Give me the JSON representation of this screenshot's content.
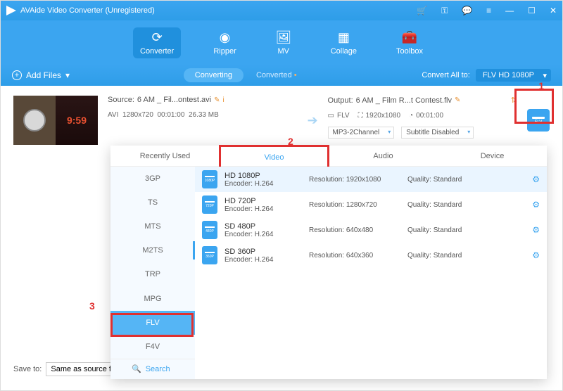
{
  "title": "AVAide Video Converter (Unregistered)",
  "nav": {
    "converter": "Converter",
    "ripper": "Ripper",
    "mv": "MV",
    "collage": "Collage",
    "toolbox": "Toolbox"
  },
  "addFiles": "Add Files",
  "tabs": {
    "converting": "Converting",
    "converted": "Converted"
  },
  "convertAll": {
    "label": "Convert All to:",
    "value": "FLV HD 1080P"
  },
  "source": {
    "label": "Source:",
    "name": "6 AM _ Fil...ontest.avi",
    "format": "AVI",
    "res": "1280x720",
    "dur": "00:01:00",
    "size": "26.33 MB"
  },
  "output": {
    "label": "Output:",
    "name": "6 AM _ Film R...t Contest.flv",
    "container": "FLV",
    "res": "1920x1080",
    "dur": "00:01:00",
    "audio": "MP3-2Channel",
    "subtitle": "Subtitle Disabled"
  },
  "annotations": {
    "one": "1",
    "two": "2",
    "three": "3"
  },
  "ddTabs": {
    "recently": "Recently Used",
    "video": "Video",
    "audio": "Audio",
    "device": "Device"
  },
  "sideFormats": [
    "3GP",
    "TS",
    "MTS",
    "M2TS",
    "TRP",
    "MPG",
    "FLV",
    "F4V"
  ],
  "presets": [
    {
      "name": "HD 1080P",
      "badge": "1080P",
      "encoder": "Encoder: H.264",
      "resLabel": "Resolution:",
      "res": "1920x1080",
      "qLabel": "Quality:",
      "q": "Standard"
    },
    {
      "name": "HD 720P",
      "badge": "720P",
      "encoder": "Encoder: H.264",
      "resLabel": "Resolution:",
      "res": "1280x720",
      "qLabel": "Quality:",
      "q": "Standard"
    },
    {
      "name": "SD 480P",
      "badge": "480P",
      "encoder": "Encoder: H.264",
      "resLabel": "Resolution:",
      "res": "640x480",
      "qLabel": "Quality:",
      "q": "Standard"
    },
    {
      "name": "SD 360P",
      "badge": "360P",
      "encoder": "Encoder: H.264",
      "resLabel": "Resolution:",
      "res": "640x360",
      "qLabel": "Quality:",
      "q": "Standard"
    }
  ],
  "search": "Search",
  "saveTo": {
    "label": "Save to:",
    "value": "Same as source fol"
  },
  "thumbClock": "9:59"
}
